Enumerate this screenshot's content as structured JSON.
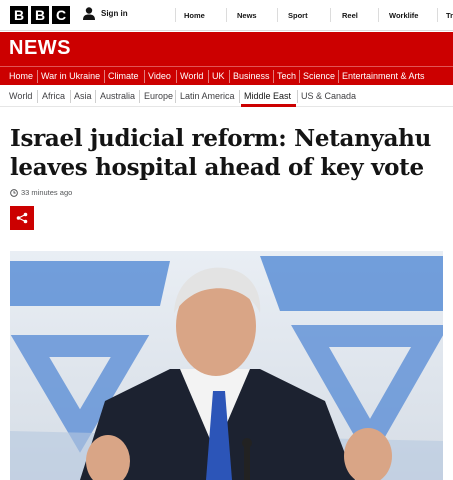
{
  "header": {
    "logo_letters": [
      "B",
      "B",
      "C"
    ],
    "signin_label": "Sign in",
    "nav": [
      "Home",
      "News",
      "Sport",
      "Reel",
      "Worklife",
      "Tr"
    ]
  },
  "banner": {
    "title": "NEWS"
  },
  "main_nav": [
    "Home",
    "War in Ukraine",
    "Climate",
    "Video",
    "World",
    "UK",
    "Business",
    "Tech",
    "Science",
    "Entertainment & Arts"
  ],
  "sub_nav": {
    "items": [
      "World",
      "Africa",
      "Asia",
      "Australia",
      "Europe",
      "Latin America",
      "Middle East",
      "US & Canada"
    ],
    "active": "Middle East"
  },
  "article": {
    "headline": "Israel judicial reform: Netanyahu leaves hospital ahead of key vote",
    "timestamp": "33 minutes ago",
    "share_icon": "share-icon"
  },
  "colors": {
    "brand_red": "#cc0000",
    "text": "#141414"
  }
}
